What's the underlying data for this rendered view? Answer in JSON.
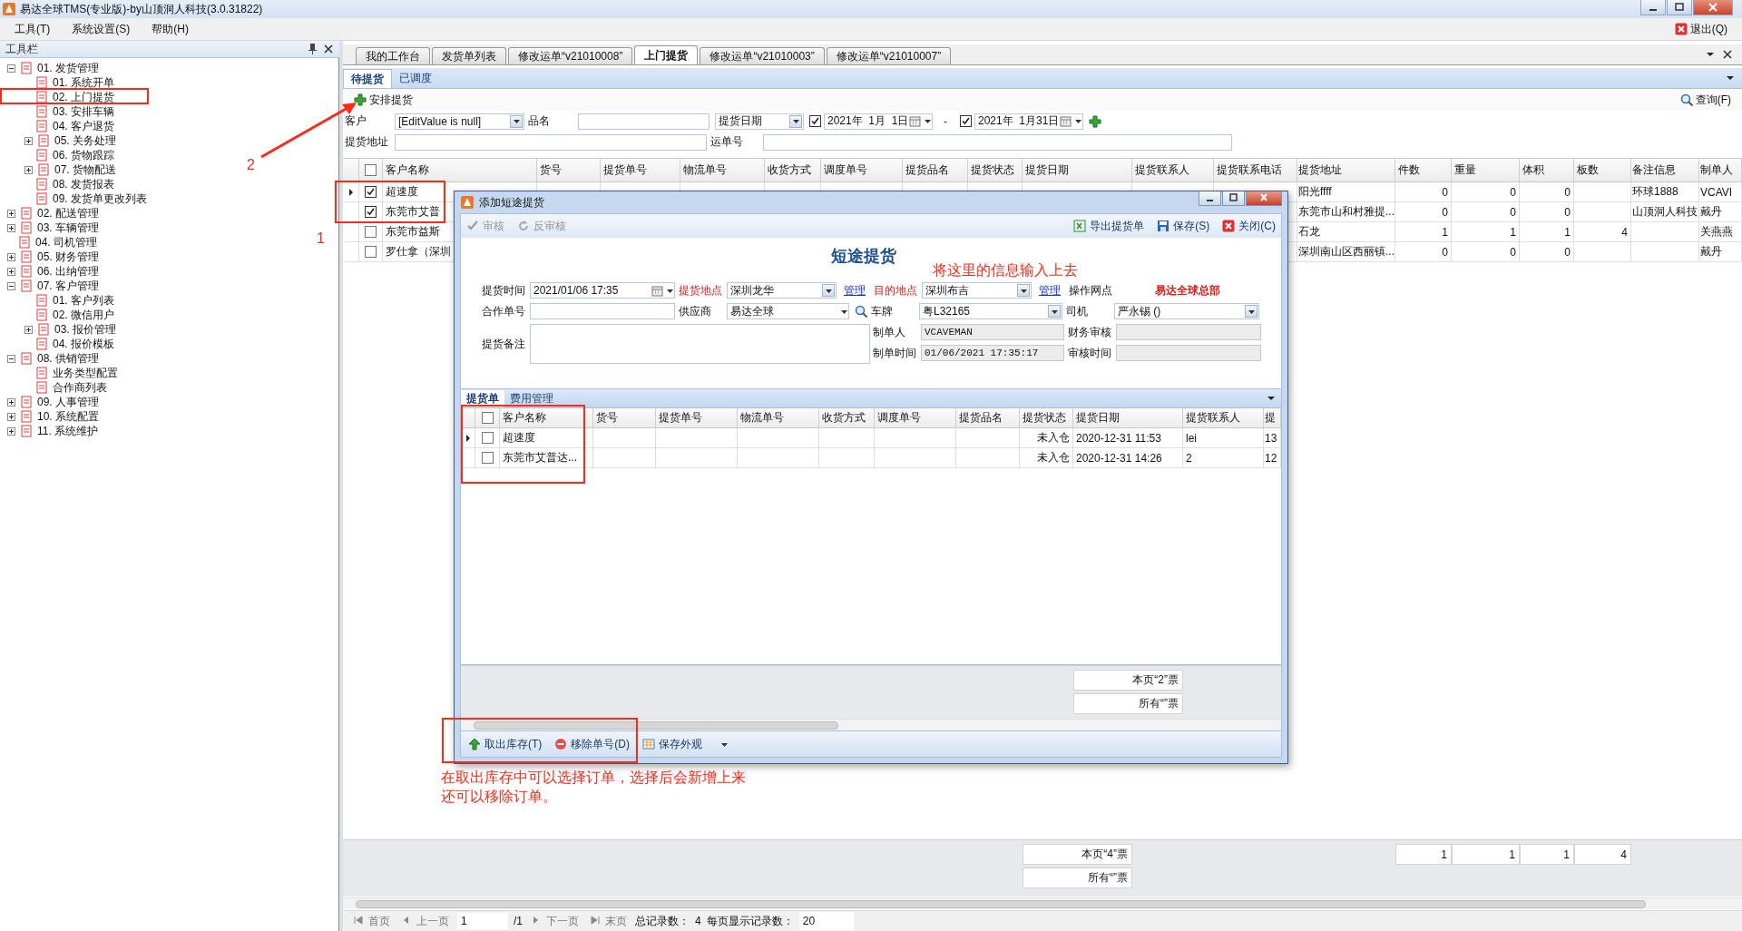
{
  "window": {
    "title": "易达全球TMS(专业版)-by山顶洞人科技(3.0.31822)"
  },
  "menu": [
    {
      "label": "工具(T)"
    },
    {
      "label": "系统设置(S)"
    },
    {
      "label": "帮助(H)"
    }
  ],
  "exit_button": {
    "label": "退出(Q)"
  },
  "sidebar": {
    "title": "工具栏",
    "items": [
      {
        "label": "01. 发货管理",
        "expanded": true,
        "children": [
          {
            "label": "01. 系统开单"
          },
          {
            "label": "02. 上门提货"
          },
          {
            "label": "03. 安排车辆"
          },
          {
            "label": "04. 客户退货"
          },
          {
            "label": "05. 关务处理",
            "expanded": false
          },
          {
            "label": "06. 货物跟踪"
          },
          {
            "label": "07. 货物配送",
            "expanded": false
          },
          {
            "label": "08. 发货报表"
          },
          {
            "label": "09. 发货单更改列表"
          }
        ]
      },
      {
        "label": "02. 配送管理",
        "expanded": false
      },
      {
        "label": "03. 车辆管理",
        "expanded": false
      },
      {
        "label": "04. 司机管理"
      },
      {
        "label": "05. 财务管理",
        "expanded": false
      },
      {
        "label": "06. 出纳管理",
        "expanded": false
      },
      {
        "label": "07. 客户管理",
        "expanded": true,
        "children": [
          {
            "label": "01. 客户列表"
          },
          {
            "label": "02. 微信用户"
          },
          {
            "label": "03. 报价管理",
            "expanded": false
          },
          {
            "label": "04. 报价模板"
          }
        ]
      },
      {
        "label": "08. 供销管理",
        "expanded": true,
        "children": [
          {
            "label": "业务类型配置"
          },
          {
            "label": "合作商列表"
          }
        ]
      },
      {
        "label": "09. 人事管理",
        "expanded": false
      },
      {
        "label": "10. 系统配置",
        "expanded": false
      },
      {
        "label": "11. 系统维护",
        "expanded": false
      }
    ]
  },
  "doc_tabs": [
    {
      "label": "我的工作台",
      "selected": false
    },
    {
      "label": "发货单列表",
      "selected": false
    },
    {
      "label": "修改运单“v21010008”",
      "selected": false
    },
    {
      "label": "上门提货",
      "selected": true
    },
    {
      "label": "修改运单“v21010003”",
      "selected": false
    },
    {
      "label": "修改运单“v21010007”",
      "selected": false
    }
  ],
  "sub_tabs": [
    {
      "label": "待提货",
      "selected": true
    },
    {
      "label": "已调度",
      "selected": false
    }
  ],
  "toolbar": {
    "add_button": "安排提货",
    "query_button": "查询(F)"
  },
  "filters": {
    "customer_label": "客户",
    "customer_value": "[EditValue is null]",
    "product_label": "品名",
    "date_type": "提货日期",
    "date_from": {
      "checked": true,
      "value": "2021年  1月  1日"
    },
    "dash": "-",
    "date_to": {
      "checked": true,
      "value": "2021年  1月31日"
    },
    "address_label": "提货地址",
    "waybill_label": "运单号"
  },
  "table": {
    "select_all_checked": false,
    "columns": [
      "客户名称",
      "货号",
      "提货单号",
      "物流单号",
      "收货方式",
      "调度单号",
      "提货品名",
      "提货状态",
      "提货日期",
      "提货联系人",
      "提货联系电话",
      "提货地址",
      "件数",
      "重量",
      "体积",
      "板数",
      "备注信息",
      "制单人"
    ],
    "rows": [
      {
        "current": true,
        "checked": true,
        "customer": "超速度",
        "address": "阳光ffff",
        "pieces": "0",
        "weight": "0",
        "volume": "0",
        "remark": "环球1888",
        "creator": "VCAVI"
      },
      {
        "current": false,
        "checked": true,
        "customer": "东莞市艾普",
        "address": "东莞市山和村雅提...",
        "pieces": "0",
        "weight": "0",
        "volume": "0",
        "remark": "山顶洞人科技",
        "creator": "戴丹"
      },
      {
        "current": false,
        "checked": false,
        "customer": "东莞市益斯",
        "address": "石龙",
        "pieces": "1",
        "weight": "1",
        "volume": "1",
        "pallets": "4",
        "creator": "关燕燕"
      },
      {
        "current": false,
        "checked": false,
        "customer": "罗仕拿（深圳",
        "address": "深圳南山区西丽镇...",
        "pieces": "0",
        "weight": "0",
        "volume": "0",
        "creator": "戴丹"
      }
    ]
  },
  "summary": {
    "page_total": "本页“4”票",
    "all_total": "所有“”票",
    "pieces": "1",
    "weight": "1",
    "volume": "1",
    "pallets": "4"
  },
  "pager": {
    "first": "首页",
    "prev": "上一页",
    "page": "1",
    "of": "/1",
    "next": "下一页",
    "last": "末页",
    "total_label": "总记录数：",
    "total": "4",
    "per_page_label": "每页显示记录数：",
    "per_page": "20"
  },
  "dialog": {
    "title": "添加短途提货",
    "toolbar_left": [
      {
        "label": "审核",
        "kind": "approve",
        "disabled": true
      },
      {
        "label": "反审核",
        "kind": "unapprove",
        "disabled": true
      }
    ],
    "toolbar_right": [
      {
        "label": "导出提货单",
        "kind": "export",
        "disabled": false
      },
      {
        "label": "保存(S)",
        "kind": "save",
        "disabled": false
      },
      {
        "label": "关闭(C)",
        "kind": "close",
        "disabled": false
      }
    ],
    "heading": "短途提货",
    "form": {
      "pickup_time": {
        "label": "提货时间",
        "value": "2021/01/06 17:35"
      },
      "pickup_place": {
        "label": "提货地点",
        "required": true,
        "value": "深圳龙华",
        "link": "管理"
      },
      "destination": {
        "label": "目的地点",
        "required": true,
        "value": "深圳布吉",
        "link": "管理"
      },
      "branch": {
        "label": "操作网点",
        "value": "易达全球总部"
      },
      "partner_no": {
        "label": "合作单号"
      },
      "supplier": {
        "label": "供应商",
        "value": "易达全球"
      },
      "plate": {
        "label": "车牌",
        "value": "粤L32165"
      },
      "driver": {
        "label": "司机",
        "value": "严永锡 ()"
      },
      "remark": {
        "label": "提货备注"
      },
      "creator": {
        "label": "制单人",
        "value": "VCAVEMAN"
      },
      "finance_review": {
        "label": "财务审核"
      },
      "created_at": {
        "label": "制单时间",
        "value": "01/06/2021 17:35:17"
      },
      "review_time": {
        "label": "审核时间"
      }
    },
    "detail_tabs": [
      {
        "label": "提货单",
        "selected": true
      },
      {
        "label": "费用管理",
        "selected": false
      }
    ],
    "grid": {
      "select_all_checked": false,
      "columns": [
        "客户名称",
        "货号",
        "提货单号",
        "物流单号",
        "收货方式",
        "调度单号",
        "提货品名",
        "提货状态",
        "提货日期",
        "提货联系人",
        "提"
      ],
      "rows": [
        {
          "current": true,
          "checked": false,
          "customer": "超速度",
          "status": "未入仓",
          "date": "2020-12-31 11:53",
          "contact": "lei",
          "phone": "13"
        },
        {
          "current": false,
          "checked": false,
          "customer": "东莞市艾普达...",
          "status": "未入仓",
          "date": "2020-12-31 14:26",
          "contact": "2",
          "phone": "12"
        }
      ]
    },
    "summary": {
      "page_total": "本页“2”票",
      "all_total": "所有“”票"
    },
    "bottom_toolbar": [
      {
        "label": "取出库存(T)",
        "kind": "take"
      },
      {
        "label": "移除单号(D)",
        "kind": "remove"
      },
      {
        "label": "保存外观",
        "kind": "layout"
      }
    ]
  },
  "annotations": [
    {
      "kind": "frame"
    },
    {
      "kind": "frame"
    },
    {
      "kind": "frame"
    },
    {
      "kind": "frame"
    },
    {
      "kind": "arrow"
    },
    {
      "kind": "number",
      "text": "1"
    },
    {
      "kind": "number",
      "text": "2"
    },
    {
      "kind": "note",
      "text": "将这里的信息输入上去"
    },
    {
      "kind": "note",
      "text": "在取出库存中可以选择订单，选择后会新增上来还可以移除订单。"
    }
  ]
}
